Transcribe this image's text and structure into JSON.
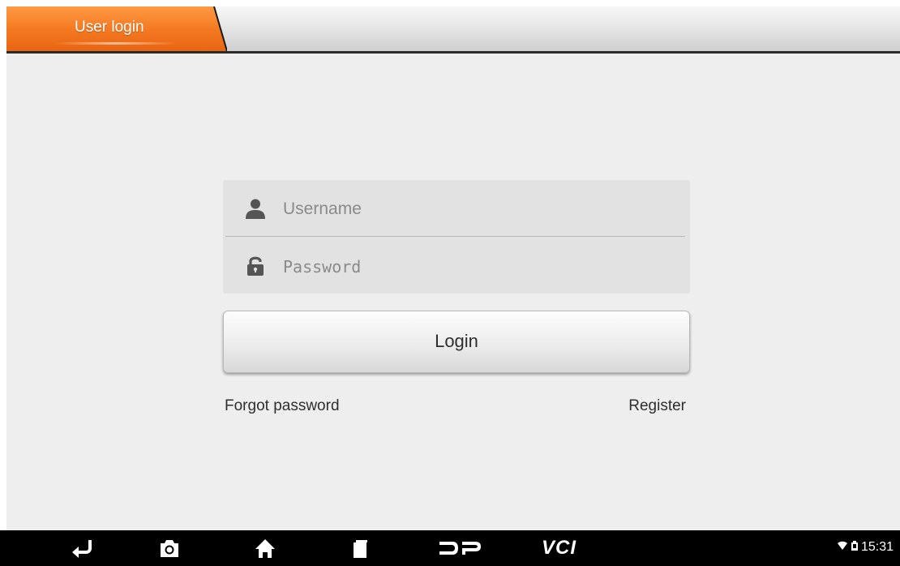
{
  "tabs": [
    {
      "label": "User login",
      "active": true
    }
  ],
  "form": {
    "username_placeholder": "Username",
    "password_placeholder": "Password",
    "login_label": "Login",
    "forgot_label": "Forgot password",
    "register_label": "Register"
  },
  "navbar": {
    "items": [
      "back-icon",
      "camera-icon",
      "home-icon",
      "recent-apps-icon",
      "dp-icon",
      "vci-label"
    ],
    "vci_label": "VCI",
    "status_time": "15:31"
  },
  "colors": {
    "tab_accent": "#f07a22",
    "background": "#eeeeee",
    "navbar": "#000000"
  }
}
